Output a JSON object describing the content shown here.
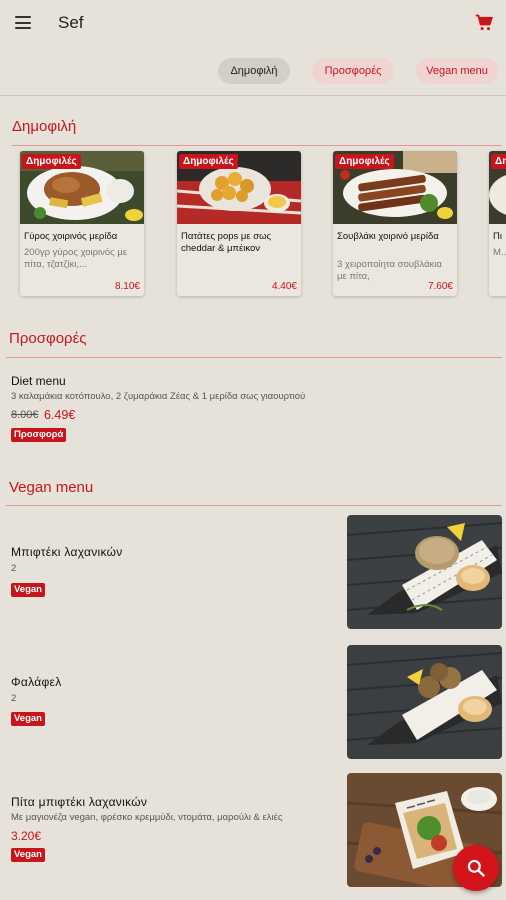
{
  "app": {
    "title": "Sef"
  },
  "chips": [
    "Δημοφιλή",
    "Προσφορές",
    "Vegan menu"
  ],
  "popular": {
    "title": "Δημοφιλή",
    "badge": "Δημοφιλές",
    "cards": [
      {
        "title": "Γύρος χοιρινός μερίδα",
        "desc": "200γρ γύρος χοιρινός με πίτα, τζατζίκι,...",
        "price": "8.10€"
      },
      {
        "title": "Πατάτες pops με σως cheddar & μπέικον",
        "desc": "",
        "price": "4.40€"
      },
      {
        "title": "Σουβλάκι χοιρινό μερίδα",
        "desc": "3 χειροποίητα σουβλάκια με πίτα,",
        "price": "7.60€"
      },
      {
        "title": "Πι",
        "desc": "Μ... τ...",
        "price": ""
      }
    ]
  },
  "offers": {
    "title": "Προσφορές",
    "item": {
      "name": "Diet menu",
      "desc": "3 καλαμάκια κοτόπουλο, 2 ζυμαράκια Ζέας & 1 μερίδα σως γιαουρτιού",
      "old_price": "8.00€",
      "new_price": "6.49€",
      "tag": "Προσφορά"
    }
  },
  "vegan": {
    "title": "Vegan menu",
    "tag": "Vegan",
    "items": [
      {
        "name": "Μπιφτέκι λαχανικών",
        "sub": "2",
        "price": ""
      },
      {
        "name": "Φαλάφελ",
        "sub": "2",
        "price": ""
      },
      {
        "name": "Πίτα μπιφτέκι λαχανικών",
        "sub": "Με μαγιονέζα vegan, φρέσκο κρεμμύδι, ντομάτα, μαρούλι & ελιές",
        "price": "3.20€"
      }
    ]
  },
  "colors": {
    "accent": "#c8151b",
    "background": "#e7e2d9"
  },
  "icons": {
    "menu": "menu-icon",
    "cart": "cart-icon",
    "search": "search-icon"
  }
}
